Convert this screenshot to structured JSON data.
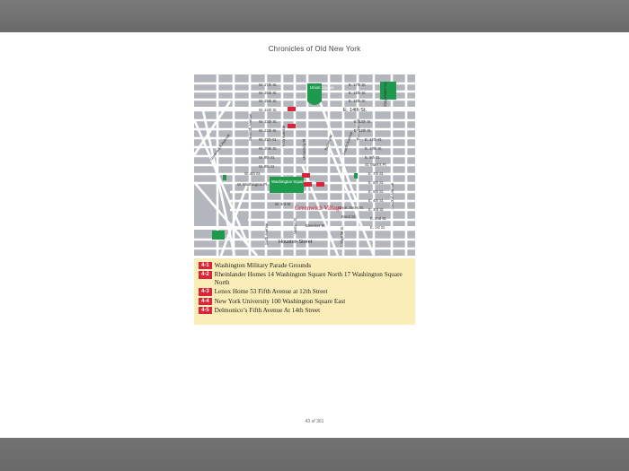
{
  "book": {
    "title": "Chronicles of Old New York"
  },
  "map": {
    "areas": {
      "union_square": "Union Square",
      "washington_square_park": "Washington Square Park",
      "village": "Greenwich Village"
    },
    "street_labels": {
      "w17": "W. 17th St.",
      "w16": "W. 16th St.",
      "w15": "W. 15th St.",
      "w14": "W. 14th St.",
      "w13": "W. 13th St.",
      "w12": "W. 12th St.",
      "w11": "W. 11th St.",
      "w10": "W. 10th St.",
      "w9": "W. 9th St.",
      "w8": "W. 8th St.",
      "e17": "E. 17th St.",
      "e16": "E. 16th St.",
      "e15": "E. 15th St.",
      "e14": "E. 14th St.",
      "e13": "E. 13th St.",
      "e12": "E. 12th St.",
      "e11": "E. 11th St.",
      "e10": "E. 10th St.",
      "e9": "E. 9th St.",
      "st_marks": "St. Mark's Pl.",
      "e7": "E. 7th St.",
      "e6": "E. 6th St.",
      "e5": "E. 5th St.",
      "e4": "E. 4th St.",
      "e3": "E. 3rd St.",
      "e2": "E. 2nd St.",
      "e1": "E. 1st St.",
      "great_jones": "Great Jones St.",
      "bond": "Bond St.",
      "w4": "W. 4th St.",
      "w3": "W. 3rd St.",
      "washington_pl": "W. Washington Pl.",
      "bleecker": "Bleecker St.",
      "houston": "Houston Street",
      "fifth": "Fifth Avenue",
      "university": "University Pl.",
      "broadway": "Broadway",
      "fourth": "Fourth Avenue",
      "third": "Third Avenue",
      "second": "Second Avenue",
      "seventh": "Seventh Avenue",
      "sixth": "Sixth Avenue",
      "lafayette": "Lafayette St.",
      "mercer": "Mercer St.",
      "greenwich": "Greenwich Avenue",
      "stuyvesant": "Stuyvesant Sq."
    }
  },
  "legend": [
    {
      "badge": "4-1",
      "text": "Washington Military Parade Grounds"
    },
    {
      "badge": "4-2",
      "text": "Rheinlander Homes 14 Washington Square North 17 Washington Square North"
    },
    {
      "badge": "4-3",
      "text": "Lenox Home 53 Fifth Avenue at 12th Street"
    },
    {
      "badge": "4-4",
      "text": "New York University 100 Washington Square East"
    },
    {
      "badge": "4-5",
      "text": "Delmonico’s Fifth Avenue At 14th Street"
    }
  ],
  "footer": {
    "page_indicator": "43 of 361"
  },
  "colors": {
    "park": "#1d9a4e",
    "marker": "#d9243a",
    "legend_bg": "#faedb8",
    "village": "#c8102e"
  }
}
